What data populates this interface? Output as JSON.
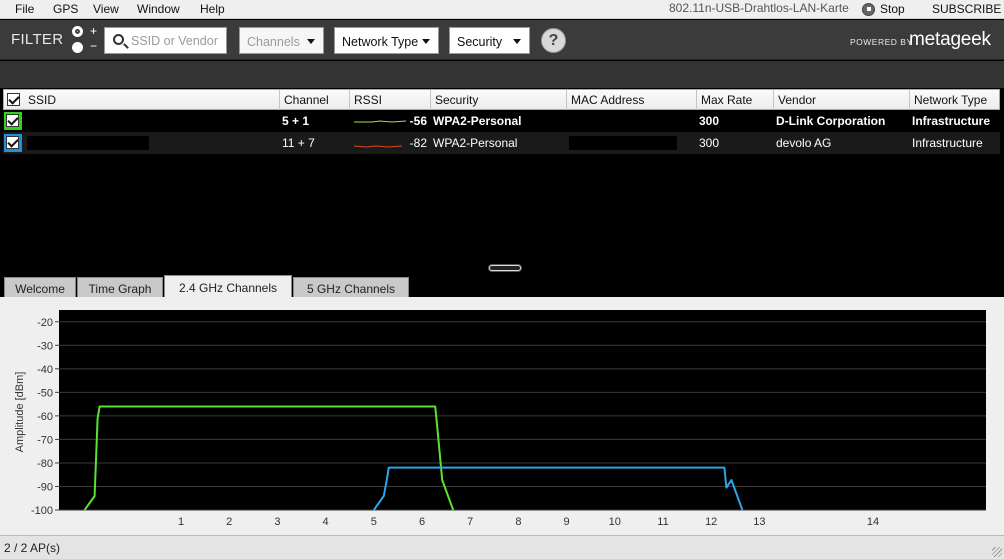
{
  "menu": {
    "items": [
      "File",
      "GPS",
      "View",
      "Window",
      "Help"
    ],
    "adapter_name": "802.11n-USB-Drahtlos-LAN-Karte",
    "stop_label": "Stop",
    "subscribe_label": "SUBSCRIBE"
  },
  "filter": {
    "label": "FILTER",
    "plus": "+",
    "minus": "−",
    "search_placeholder": "SSID or Vendor",
    "channels_label": "Channels",
    "network_type_label": "Network Type",
    "security_label": "Security",
    "help_label": "?",
    "powered_by": "POWERED BY",
    "brand": "metageek"
  },
  "table": {
    "headers": [
      "SSID",
      "Channel",
      "RSSI",
      "Security",
      "MAC Address",
      "Max Rate",
      "Vendor",
      "Network Type"
    ],
    "rows": [
      {
        "ssid": "",
        "channel": "5 + 1",
        "rssi": "-56",
        "security": "WPA2-Personal",
        "mac": "",
        "max_rate": "300",
        "vendor": "D-Link Corporation",
        "network_type": "Infrastructure",
        "color": "#33d11f",
        "rssi_line": "#a6e24a",
        "bold": true
      },
      {
        "ssid": "",
        "channel": "11 + 7",
        "rssi": "-82",
        "security": "WPA2-Personal",
        "mac": "",
        "max_rate": "300",
        "vendor": "devolo AG",
        "network_type": "Infrastructure",
        "color": "#1f8fe0",
        "rssi_line": "#d9481c",
        "bold": false
      }
    ]
  },
  "tabs": [
    "Welcome",
    "Time Graph",
    "2.4 GHz Channels",
    "5 GHz Channels"
  ],
  "active_tab": "2.4 GHz Channels",
  "status": {
    "ap_count": "2 / 2 AP(s)"
  },
  "chart_data": {
    "type": "line",
    "ylabel": "Amplitude [dBm]",
    "ylim": [
      -100,
      -15
    ],
    "yticks": [
      -20,
      -30,
      -40,
      -50,
      -60,
      -70,
      -80,
      -90,
      -100
    ],
    "xticks": [
      "1",
      "2",
      "3",
      "4",
      "5",
      "6",
      "7",
      "8",
      "9",
      "10",
      "11",
      "12",
      "13",
      "14"
    ],
    "grid": true,
    "series": [
      {
        "color": "#5ce22e",
        "channel_center": 3,
        "amplitude": -56,
        "from_channel": -1.0,
        "to_channel": 7.0
      },
      {
        "color": "#2ea4ec",
        "channel_center": 9,
        "amplitude": -82,
        "from_channel": 5.0,
        "to_channel": 13.0
      }
    ]
  }
}
